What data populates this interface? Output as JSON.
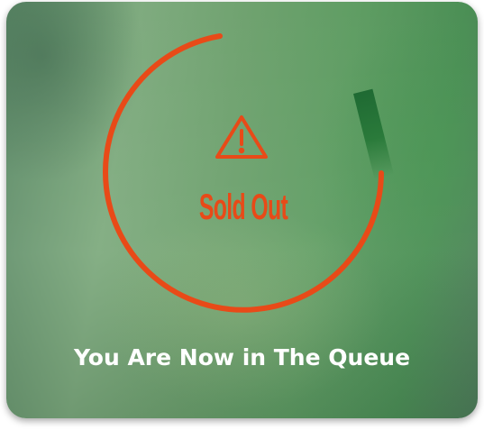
{
  "status": {
    "title": "Sold Out",
    "icon": "warning-icon",
    "accent_color": "#e84a18"
  },
  "message": {
    "text": "You Are Now in The Queue",
    "color": "#ffffff"
  }
}
